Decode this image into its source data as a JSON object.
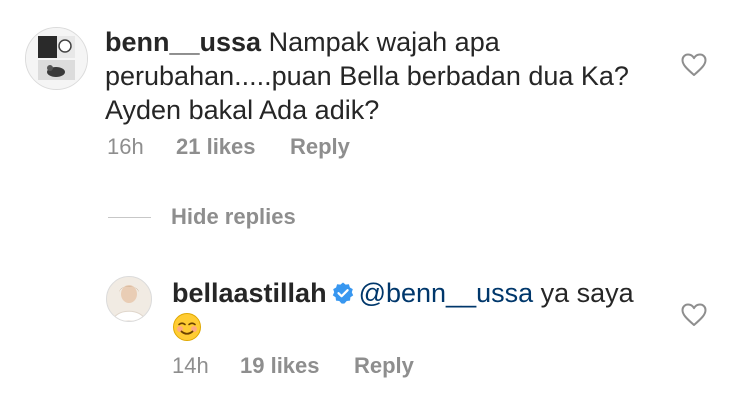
{
  "comments": [
    {
      "username": "benn__ussa",
      "text": "Nampak wajah apa perubahan.....puan Bella berbadan dua Ka? Ayden bakal Ada adik?",
      "time": "16h",
      "likes": "21 likes",
      "reply_label": "Reply",
      "avatar_icon": "profile-photo-collage",
      "heart_icon": "heart-outline-icon"
    }
  ],
  "hide_replies_label": "Hide replies",
  "replies": [
    {
      "username": "bellaastillah",
      "verified": true,
      "verified_color": "#3897f0",
      "mention": "@benn__ussa",
      "text": " ya saya",
      "emoji": "☺️",
      "time": "14h",
      "likes": "19 likes",
      "reply_label": "Reply",
      "avatar_icon": "profile-photo",
      "heart_icon": "heart-outline-icon"
    }
  ],
  "colors": {
    "primary_text": "#262626",
    "secondary_text": "#8e8e8e",
    "mention": "#00376b",
    "divider": "#c7c7c7"
  }
}
